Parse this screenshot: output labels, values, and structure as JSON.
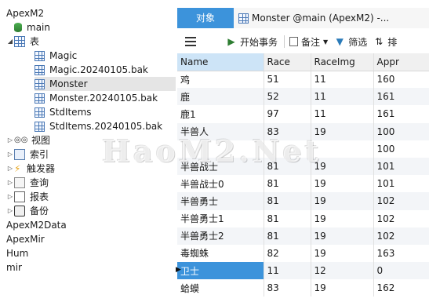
{
  "tree": {
    "items": [
      {
        "label": "ApexM2",
        "level": 0,
        "icon": "",
        "expanded": true
      },
      {
        "label": "main",
        "level": 0,
        "icon": "database-icon",
        "expanded": true
      },
      {
        "label": "表",
        "level": 0,
        "icon": "table-group-icon",
        "expanded": true
      },
      {
        "label": "Magic",
        "level": 1,
        "icon": "table-icon"
      },
      {
        "label": "Magic.20240105.bak",
        "level": 1,
        "icon": "table-icon"
      },
      {
        "label": "Monster",
        "level": 1,
        "icon": "table-icon",
        "selected": true
      },
      {
        "label": "Monster.20240105.bak",
        "level": 1,
        "icon": "table-icon"
      },
      {
        "label": "StdItems",
        "level": 1,
        "icon": "table-icon"
      },
      {
        "label": "StdItems.20240105.bak",
        "level": 1,
        "icon": "table-icon"
      },
      {
        "label": "视图",
        "level": 0,
        "icon": "view-icon"
      },
      {
        "label": "索引",
        "level": 0,
        "icon": "index-icon"
      },
      {
        "label": "触发器",
        "level": 0,
        "icon": "trigger-icon"
      },
      {
        "label": "查询",
        "level": 0,
        "icon": "query-icon"
      },
      {
        "label": "报表",
        "level": 0,
        "icon": "report-icon"
      },
      {
        "label": "备份",
        "level": 0,
        "icon": "backup-icon"
      },
      {
        "label": "ApexM2Data",
        "level": 0,
        "icon": ""
      },
      {
        "label": "ApexMir",
        "level": 0,
        "icon": ""
      },
      {
        "label": "Hum",
        "level": 0,
        "icon": ""
      },
      {
        "label": "mir",
        "level": 0,
        "icon": ""
      }
    ]
  },
  "tabs": {
    "objects_label": "对象",
    "monster_label": "Monster @main (ApexM2) -..."
  },
  "toolbar": {
    "begin_transaction": "开始事务",
    "note": "备注",
    "filter": "筛选",
    "sort": "排"
  },
  "grid": {
    "columns": [
      "Name",
      "Race",
      "RaceImg",
      "Appr"
    ],
    "rows": [
      [
        "鸡",
        "51",
        "11",
        "160"
      ],
      [
        "鹿",
        "52",
        "11",
        "161"
      ],
      [
        "鹿1",
        "97",
        "11",
        "161"
      ],
      [
        "半兽人",
        "83",
        "19",
        "100"
      ],
      [
        "",
        "",
        "",
        "100"
      ],
      [
        "半兽战士",
        "81",
        "19",
        "101"
      ],
      [
        "半兽战士0",
        "81",
        "19",
        "101"
      ],
      [
        "半兽勇士",
        "81",
        "19",
        "102"
      ],
      [
        "半兽勇士1",
        "81",
        "19",
        "102"
      ],
      [
        "半兽勇士2",
        "81",
        "19",
        "102"
      ],
      [
        "毒蜘蛛",
        "82",
        "19",
        "163"
      ],
      [
        "卫士",
        "11",
        "12",
        "0"
      ],
      [
        "蛤蟆",
        "83",
        "19",
        "162"
      ]
    ],
    "current_row_index": 11
  },
  "watermark": "HaoM2.Net",
  "colors": {
    "accent": "#3c93db",
    "selected_tree_bg": "#e5e5e5",
    "tab_bar": "#cfd6df"
  }
}
